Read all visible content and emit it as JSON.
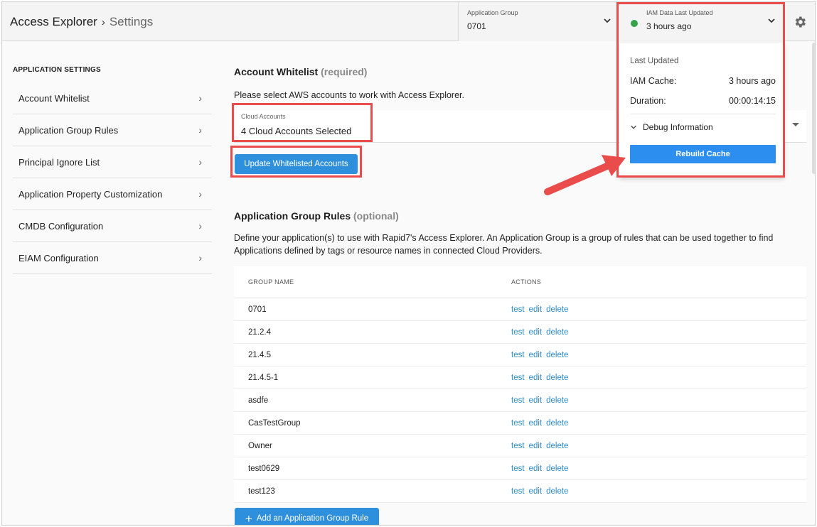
{
  "header": {
    "breadcrumb_app": "Access Explorer",
    "breadcrumb_sep": "›",
    "breadcrumb_page": "Settings",
    "app_group": {
      "label": "Application Group",
      "value": "0701"
    },
    "iam": {
      "label": "IAM Data Last Updated",
      "value": "3 hours ago",
      "status_color": "#35a34a"
    }
  },
  "dropdown": {
    "subtitle": "Last Updated",
    "iam_cache_label": "IAM Cache:",
    "iam_cache_value": "3 hours ago",
    "duration_label": "Duration:",
    "duration_value": "00:00:14:15",
    "debug_label": "Debug Information",
    "rebuild_label": "Rebuild Cache"
  },
  "sidebar": {
    "title": "APPLICATION SETTINGS",
    "items": [
      {
        "label": "Account Whitelist"
      },
      {
        "label": "Application Group Rules"
      },
      {
        "label": "Principal Ignore List"
      },
      {
        "label": "Application Property Customization"
      },
      {
        "label": "CMDB Configuration"
      },
      {
        "label": "EIAM Configuration"
      }
    ]
  },
  "whitelist": {
    "title": "Account Whitelist",
    "tag": "(required)",
    "description": "Please select AWS accounts to work with Access Explorer.",
    "field_label": "Cloud Accounts",
    "field_value": "4 Cloud Accounts Selected",
    "update_button": "Update Whitelisted Accounts"
  },
  "groups": {
    "title": "Application Group Rules",
    "tag": "(optional)",
    "description": "Define your application(s) to use with Rapid7's Access Explorer. An Application Group is a group of rules that can be used together to find Applications defined by tags or resource names in connected Cloud Providers.",
    "col_name": "GROUP NAME",
    "col_actions": "ACTIONS",
    "actions": {
      "test": "test",
      "edit": "edit",
      "delete": "delete"
    },
    "rows": [
      {
        "name": "0701"
      },
      {
        "name": "21.2.4"
      },
      {
        "name": "21.4.5"
      },
      {
        "name": "21.4.5-1"
      },
      {
        "name": "asdfe"
      },
      {
        "name": "CasTestGroup"
      },
      {
        "name": "Owner"
      },
      {
        "name": "test0629"
      },
      {
        "name": "test123"
      }
    ],
    "add_button": "Add an Application Group Rule"
  },
  "colors": {
    "accent": "#2e8fdc",
    "link": "#2b8ac9",
    "annotation": "#ea4b4b"
  }
}
